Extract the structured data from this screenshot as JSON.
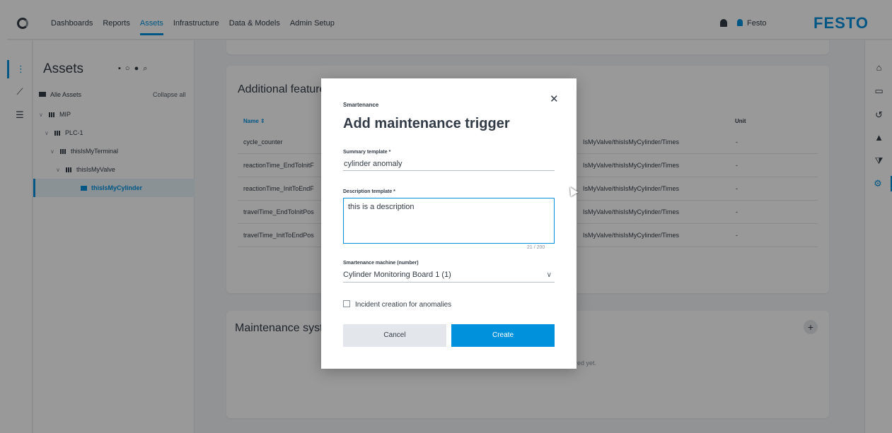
{
  "topbar": {
    "nav": [
      {
        "label": "Dashboards"
      },
      {
        "label": "Reports"
      },
      {
        "label": "Assets"
      },
      {
        "label": "Infrastructure"
      },
      {
        "label": "Data & Models"
      },
      {
        "label": "Admin Setup"
      }
    ],
    "active_nav": "Assets",
    "user": "Festo",
    "brand": "FESTO",
    "accent": "#0091dc"
  },
  "tree": {
    "title": "Assets",
    "all_assets": "Alle Assets",
    "collapse_all": "Collapse all",
    "nodes": [
      {
        "label": "MIP"
      },
      {
        "label": "PLC-1"
      },
      {
        "label": "thisIsMyTerminal"
      },
      {
        "label": "thisIsMyValve"
      },
      {
        "label": "thisIsMyCylinder"
      }
    ]
  },
  "features": {
    "title": "Additional feature",
    "col_name": "Name",
    "col_unit": "Unit",
    "rows": [
      {
        "name": "cycle_counter",
        "path": "IsMyValve/thisIsMyCylinder/Times",
        "unit": "-"
      },
      {
        "name": "reactionTime_EndToInitF",
        "path": "IsMyValve/thisIsMyCylinder/Times",
        "unit": "-"
      },
      {
        "name": "reactionTime_InitToEndF",
        "path": "IsMyValve/thisIsMyCylinder/Times",
        "unit": "-"
      },
      {
        "name": "travelTime_EndToInitPos",
        "path": "IsMyValve/thisIsMyCylinder/Times",
        "unit": "-"
      },
      {
        "name": "travelTime_InitToEndPos",
        "path": "IsMyValve/thisIsMyCylinder/Times",
        "unit": "-"
      }
    ]
  },
  "maintenance": {
    "title": "Maintenance syst",
    "empty_note": "ured yet."
  },
  "modal": {
    "eyebrow": "Smartenance",
    "title": "Add maintenance trigger",
    "summary_label": "Summary template *",
    "summary_value": "cylinder anomaly",
    "description_label": "Description template *",
    "description_value": "this is a description",
    "counter": "21 / 200",
    "machine_label": "Smartenance machine (number)",
    "machine_value": "Cylinder Monitoring Board 1 (1)",
    "checkbox_label": "Incident creation for anomalies",
    "checkbox_checked": false,
    "cancel_label": "Cancel",
    "create_label": "Create"
  }
}
